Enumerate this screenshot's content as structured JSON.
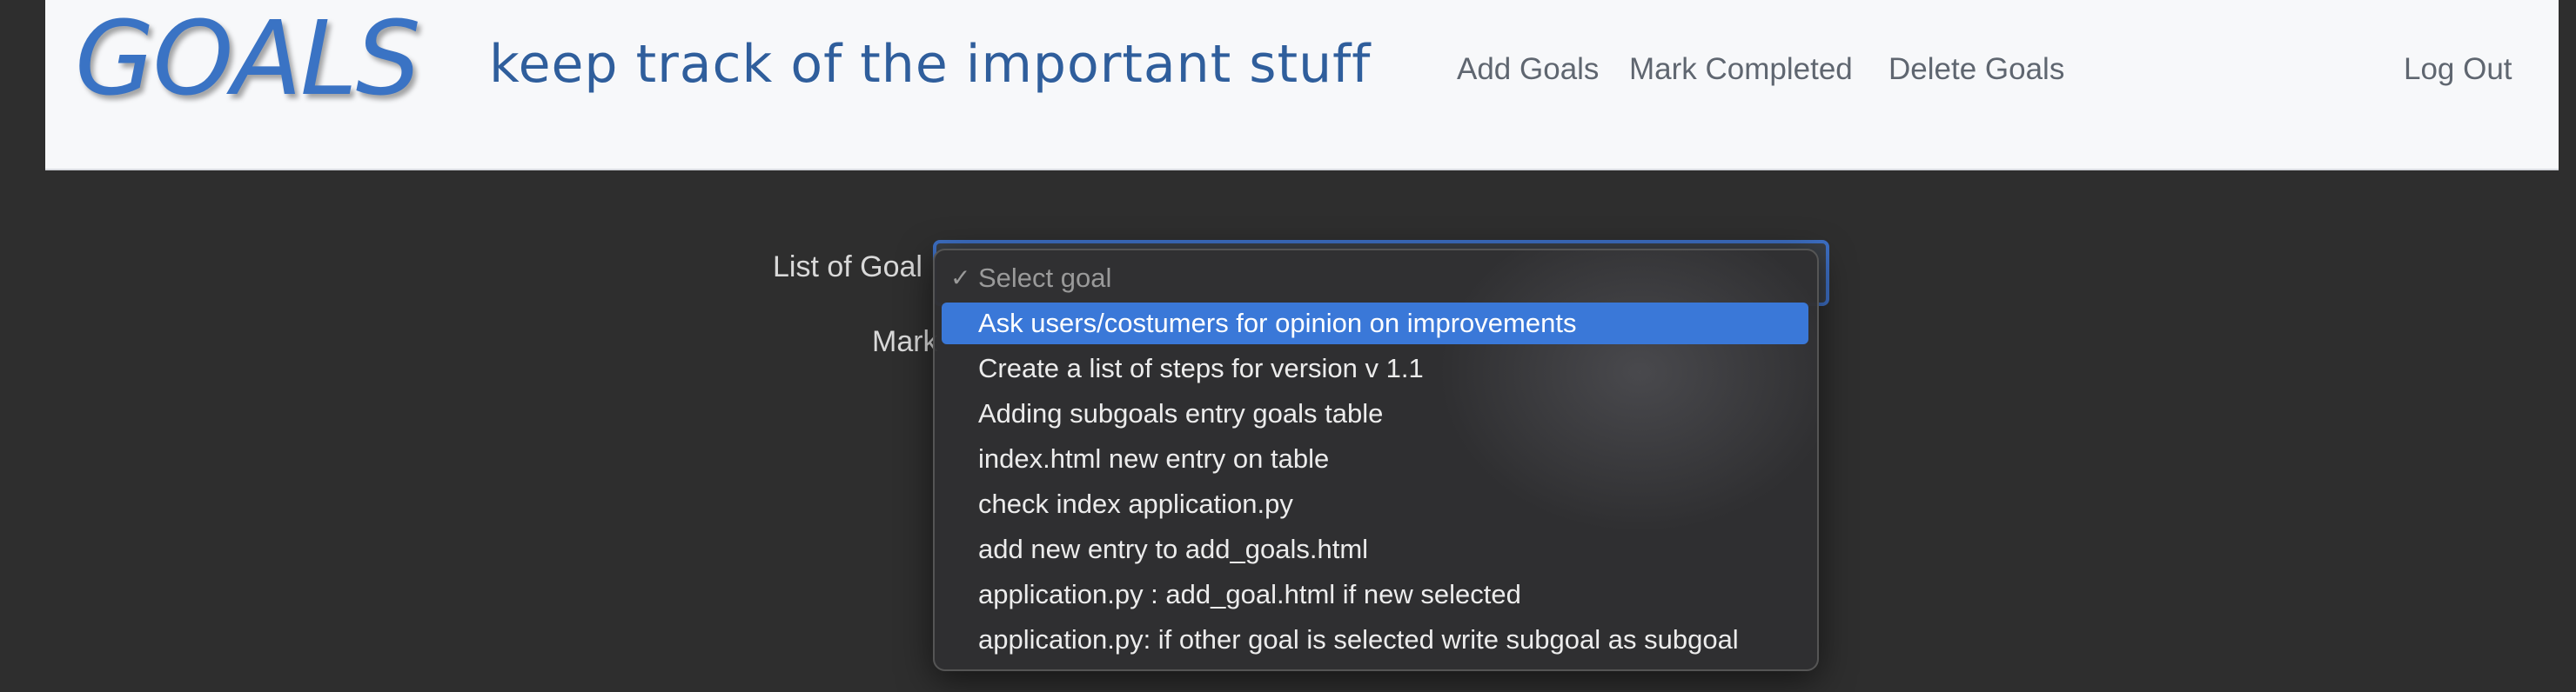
{
  "navbar": {
    "brand": "GOALS",
    "tagline": "keep track of the important stuff",
    "links": {
      "add": "Add Goals",
      "mark": "Mark Completed",
      "delete": "Delete Goals",
      "logout": "Log Out"
    }
  },
  "form": {
    "list_label": "List of Goal",
    "mark_label": "Mark"
  },
  "dropdown": {
    "check_icon": "✓",
    "placeholder": "Select goal",
    "options": [
      "Ask users/costumers for opinion on improvements",
      "Create a list of steps for version v 1.1",
      "Adding subgoals entry goals table",
      "index.html new entry on table",
      "check index application.py",
      "add new entry to add_goals.html",
      "application.py : add_goal.html if new selected",
      "application.py: if other goal is selected write subgoal as subgoal"
    ],
    "highlighted_index": 0
  },
  "colors": {
    "brand": "#3a73c4",
    "highlight": "#3a78d8",
    "background": "#2e2e2e"
  }
}
